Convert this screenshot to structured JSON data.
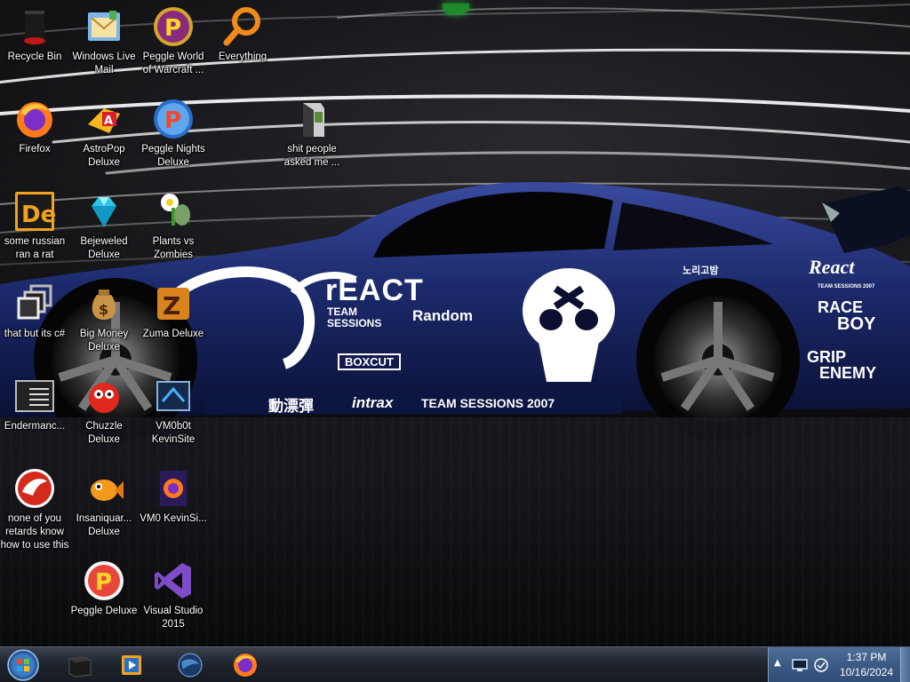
{
  "desktop": {
    "icons": [
      {
        "id": "recycle-bin",
        "label": "Recycle Bin",
        "icon": "recycle-bin-icon"
      },
      {
        "id": "windows-live-mail",
        "label": "Windows Live Mail",
        "icon": "mail-icon"
      },
      {
        "id": "peggle-world-of-warcraft",
        "label": "Peggle World of Warcraft ...",
        "icon": "peggle-icon"
      },
      {
        "id": "everything",
        "label": "Everything",
        "icon": "magnifier-icon"
      },
      {
        "id": "firefox",
        "label": "Firefox",
        "icon": "firefox-icon"
      },
      {
        "id": "astropop-deluxe",
        "label": "AstroPop Deluxe",
        "icon": "astropop-icon"
      },
      {
        "id": "peggle-nights-deluxe",
        "label": "Peggle Nights Deluxe",
        "icon": "peggle-nights-icon"
      },
      {
        "id": "shit-people-asked-me",
        "label": "shit people asked me ...",
        "icon": "folder-icon"
      },
      {
        "id": "some-russian-ran-a-rat",
        "label": "some russian ran a rat",
        "icon": "de-app-icon"
      },
      {
        "id": "bejeweled-deluxe",
        "label": "Bejeweled Deluxe",
        "icon": "gem-icon"
      },
      {
        "id": "plants-vs-zombies",
        "label": "Plants vs Zombies",
        "icon": "plant-icon"
      },
      {
        "id": "that-but-its-csharp",
        "label": "that but its c#",
        "icon": "stacked-windows-icon"
      },
      {
        "id": "big-money-deluxe",
        "label": "Big Money Deluxe",
        "icon": "money-bag-icon"
      },
      {
        "id": "zuma-deluxe",
        "label": "Zuma Deluxe",
        "icon": "zuma-icon"
      },
      {
        "id": "endermanch",
        "label": "Endermanc...",
        "icon": "console-icon"
      },
      {
        "id": "chuzzle-deluxe",
        "label": "Chuzzle Deluxe",
        "icon": "chuzzle-icon"
      },
      {
        "id": "vm0b0t-kevinsite",
        "label": "VM0b0t KevinSite",
        "icon": "vm-app-icon"
      },
      {
        "id": "none-of-you",
        "label": "none of you retards know how to use this",
        "icon": "dragon-icon"
      },
      {
        "id": "insaniquarium-deluxe",
        "label": "Insaniquar... Deluxe",
        "icon": "fish-icon"
      },
      {
        "id": "vm0-kevinsite",
        "label": "VM0 KevinSi...",
        "icon": "firefox-file-icon"
      },
      {
        "id": "peggle-deluxe",
        "label": "Peggle Deluxe",
        "icon": "peggle-icon"
      },
      {
        "id": "visual-studio-2015",
        "label": "Visual Studio 2015",
        "icon": "visual-studio-icon"
      }
    ]
  },
  "wallpaper": {
    "brand_large": "rEACT",
    "brand_sub": "TEAM SESSIONS",
    "brand_random": "Random",
    "side_text": "TEAM SESSIONS 2007",
    "sponsor_intrax": "intrax",
    "sponsor_boxcut": "BOXCUT",
    "rear_react": "React",
    "rear_react_sub": "TEAM SESSIONS 2007",
    "rear_raceboy_1": "RACE",
    "rear_raceboy_2": "BOY",
    "rear_grip_1": "GRIP",
    "rear_grip_2": "ENEMY",
    "kanji": "動漂彈",
    "korean": "노리고밤"
  },
  "taskbar": {
    "start": {
      "icon": "windows-orb-icon"
    },
    "pinned": [
      {
        "id": "task-cmd",
        "icon": "terminal-icon"
      },
      {
        "id": "task-media",
        "icon": "media-player-icon"
      },
      {
        "id": "task-ie",
        "icon": "globe-icon"
      },
      {
        "id": "task-firefox",
        "icon": "firefox-icon"
      }
    ],
    "tray": {
      "chevron": "▲",
      "time": "1:37 PM",
      "date": "10/16/2024"
    }
  },
  "colors": {
    "taskbar": "#1f242d",
    "tray": "#3b5a85",
    "car_body": "#1b2a6e",
    "accent_green": "#28b43a"
  }
}
